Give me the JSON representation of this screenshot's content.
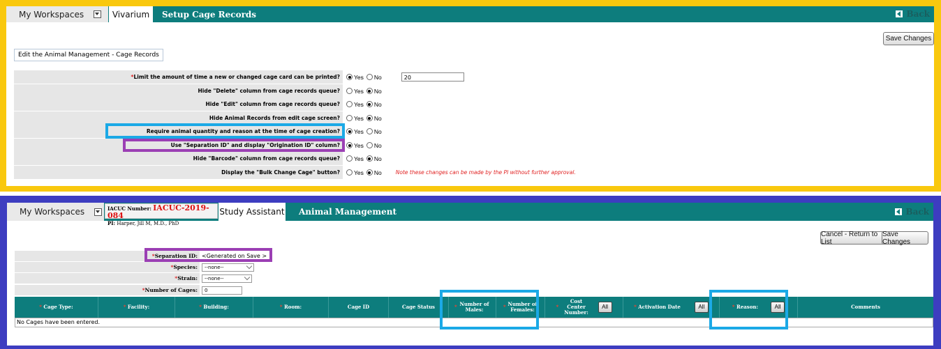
{
  "top": {
    "workspaces_label": "My Workspaces",
    "tab_active": "Vivarium",
    "title": "Setup Cage Records",
    "back_label": "Back",
    "save_label": "Save Changes",
    "edit_link": "Edit the Animal Management - Cage Records",
    "rows": [
      {
        "label": "Limit the amount of time a new or changed cage card can be printed?",
        "required": true,
        "yes": true,
        "input": "20"
      },
      {
        "label": "Hide \"Delete\" column from cage records queue?",
        "yes": false
      },
      {
        "label": "Hide \"Edit\" column from cage records queue?",
        "yes": false
      },
      {
        "label": "Hide Animal Records from edit cage screen?",
        "yes": false
      },
      {
        "label": "Require animal quantity and reason at the time of cage creation?",
        "yes": true
      },
      {
        "label": "Use \"Separation ID\" and display \"Origination ID\" column?",
        "yes": true
      },
      {
        "label": "Hide \"Barcode\" column from cage records queue?",
        "yes": false
      },
      {
        "label": "Display the \"Bulk Change Cage\" button?",
        "yes": false,
        "note": "Note these changes can be made by the PI without further approval."
      }
    ],
    "yes_label": "Yes",
    "no_label": "No"
  },
  "bottom": {
    "workspaces_label": "My Workspaces",
    "iacuc_label": "IACUC Number:",
    "iacuc_number": "IACUC-2019-084",
    "pi_label": "PI:",
    "pi_name": "Harper, Jill M, M.D., PhD",
    "tab_active": "Study Assistant",
    "title": "Animal Management",
    "back_label": "Back",
    "cancel_label": "Cancel - Return to List",
    "save_label": "Save Changes",
    "fields": {
      "separation_label": "Separation ID:",
      "separation_value": "<Generated on Save >",
      "species_label": "Species:",
      "species_value": "--none--",
      "strain_label": "Strain:",
      "strain_value": "--none--",
      "cages_label": "Number of Cages:",
      "cages_value": "0"
    },
    "columns": {
      "cage_type": "Cage Type:",
      "facility": "Facility:",
      "building": "Building:",
      "room": "Room:",
      "cage_id": "Cage ID",
      "cage_status": "Cage Status",
      "males": "Number of Males:",
      "females": "Number of Females:",
      "cost_center": "Cost Center Number:",
      "activation": "Activation Date",
      "reason": "Reason:",
      "comments": "Comments",
      "all_label": "All"
    },
    "empty_text": "No Cages have been entered."
  }
}
